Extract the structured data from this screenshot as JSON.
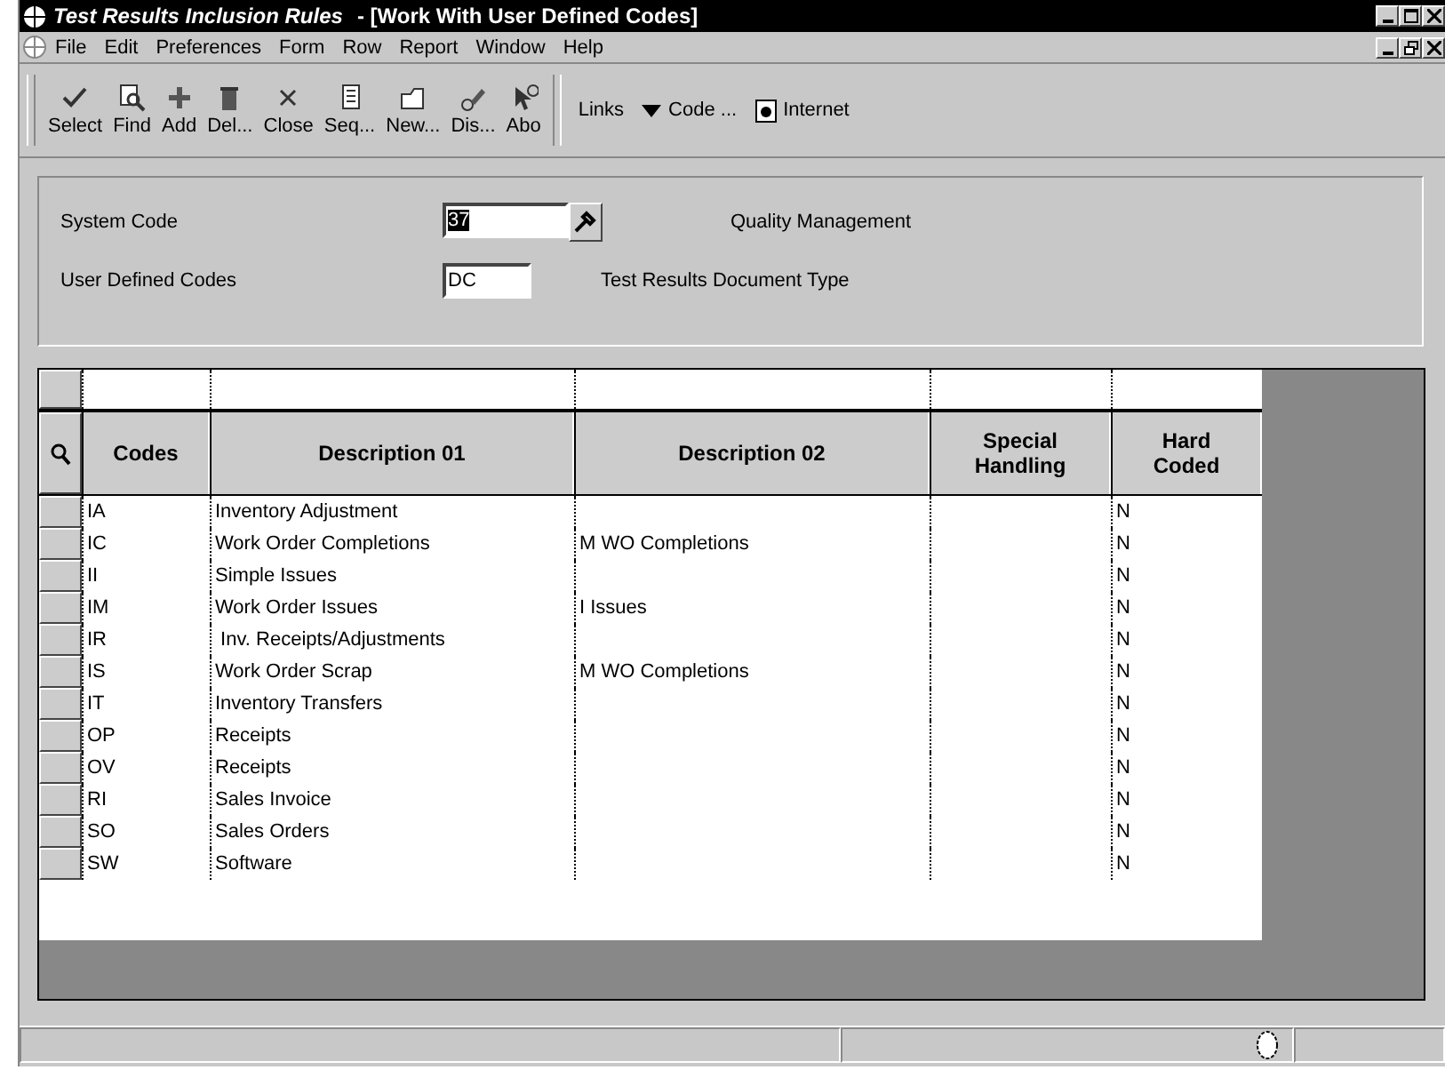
{
  "window": {
    "title": "Test Results Inclusion Rules",
    "subtitle": "- [Work With User Defined Codes]"
  },
  "menu": [
    "File",
    "Edit",
    "Preferences",
    "Form",
    "Row",
    "Report",
    "Window",
    "Help"
  ],
  "toolbar": [
    {
      "label": "Select"
    },
    {
      "label": "Find"
    },
    {
      "label": "Add"
    },
    {
      "label": "Del..."
    },
    {
      "label": "Close"
    },
    {
      "label": "Seq..."
    },
    {
      "label": "New..."
    },
    {
      "label": "Dis..."
    },
    {
      "label": "Abo"
    }
  ],
  "links": [
    {
      "label": "Links",
      "kind": "text"
    },
    {
      "label": "Code ...",
      "kind": "dropdown"
    },
    {
      "label": "Internet",
      "kind": "page"
    }
  ],
  "fields": [
    {
      "label": "System Code",
      "value": "37",
      "selected": true,
      "lookup": true,
      "description": "Quality Management"
    },
    {
      "label": "User Defined Codes",
      "value": "DC",
      "selected": false,
      "lookup": false,
      "description": "Test Results Document Type"
    }
  ],
  "table": {
    "columns": [
      "Codes",
      "Description 01",
      "Description 02",
      "Special Handling",
      "Hard Coded"
    ],
    "rows": [
      [
        "IA",
        "Inventory Adjustment",
        "",
        "",
        "N"
      ],
      [
        "IC",
        "Work Order Completions",
        "M WO Completions",
        "",
        "N"
      ],
      [
        "II",
        "Simple Issues",
        "",
        "",
        "N"
      ],
      [
        "IM",
        "Work Order Issues",
        "I Issues",
        "",
        "N"
      ],
      [
        "IR",
        " Inv. Receipts/Adjustments",
        "",
        "",
        "N"
      ],
      [
        "IS",
        "Work Order Scrap",
        "M WO Completions",
        "",
        "N"
      ],
      [
        "IT",
        "Inventory Transfers",
        "",
        "",
        "N"
      ],
      [
        "OP",
        "Receipts",
        "",
        "",
        "N"
      ],
      [
        "OV",
        "Receipts",
        "",
        "",
        "N"
      ],
      [
        "RI",
        "Sales Invoice",
        "",
        "",
        "N"
      ],
      [
        "SO",
        "Sales Orders",
        "",
        "",
        "N"
      ],
      [
        "SW",
        "Software",
        "",
        "",
        "N"
      ]
    ]
  }
}
